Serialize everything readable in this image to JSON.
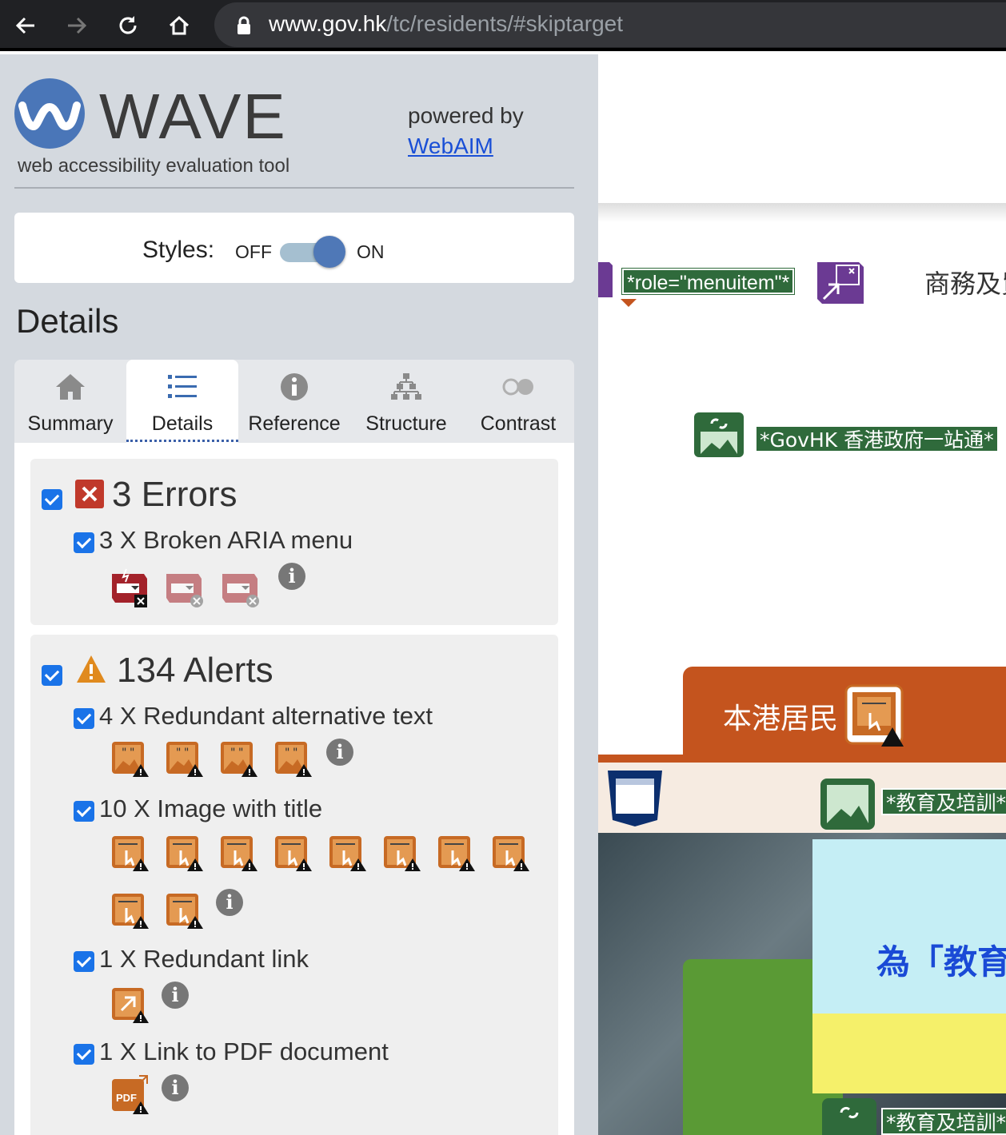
{
  "browser": {
    "url_host": "www.gov.hk",
    "url_path": "/tc/residents/#skiptarget"
  },
  "wave": {
    "logo_text": "WAVE",
    "tagline": "web accessibility evaluation tool",
    "powered_by": "powered by",
    "webaim_link": "WebAIM",
    "styles_label": "Styles:",
    "off_label": "OFF",
    "on_label": "ON",
    "styles_on": true,
    "details_heading": "Details",
    "tabs": [
      {
        "label": "Summary"
      },
      {
        "label": "Details"
      },
      {
        "label": "Reference"
      },
      {
        "label": "Structure"
      },
      {
        "label": "Contrast"
      }
    ],
    "errors": {
      "heading": "3 Errors",
      "items": [
        {
          "label": "3 X Broken ARIA menu",
          "count": 3
        }
      ]
    },
    "alerts": {
      "heading": "134 Alerts",
      "items": [
        {
          "label": "4 X Redundant alternative text",
          "count": 4
        },
        {
          "label": "10 X Image with title",
          "count": 10
        },
        {
          "label": "1 X Redundant link",
          "count": 1
        },
        {
          "label": "1 X Link to PDF document",
          "count": 1
        }
      ]
    },
    "info_symbol": "i",
    "pdf_text": "PDF"
  },
  "page": {
    "role_badge": "*role=\"menuitem\"*",
    "nav_text": "商務及貿",
    "gov_badge": "*GovHK 香港政府一站通*",
    "residents_tab": "本港居民",
    "edu_badge": "*教育及培訓*",
    "poster_text": "為「教育",
    "edu_badge2": "*教育及培訓*"
  },
  "colors": {
    "sidebar_bg": "#d4d9df",
    "accent_blue": "#4a76b8",
    "error_red": "#c0392b",
    "alert_orange": "#c4541e",
    "badge_green": "#2f6a3b"
  }
}
